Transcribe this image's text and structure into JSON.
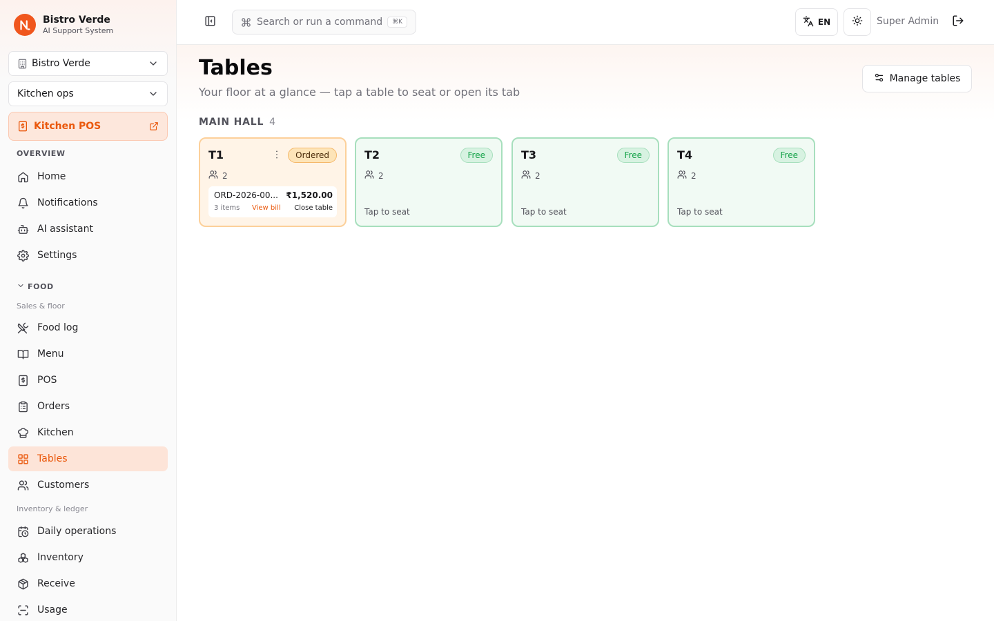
{
  "brand": {
    "name": "Bistro Verde",
    "subtitle": "AI Support System",
    "accent": "#f0561d"
  },
  "sidebar": {
    "restaurant_select": {
      "value": "Bistro Verde"
    },
    "workspace_select": {
      "value": "Kitchen ops"
    },
    "pos_link": {
      "label": "Kitchen POS"
    },
    "overview_label": "OVERVIEW",
    "overview_items": [
      {
        "label": "Home",
        "icon": "home-icon"
      },
      {
        "label": "Notifications",
        "icon": "bell-icon"
      },
      {
        "label": "AI assistant",
        "icon": "bot-icon"
      },
      {
        "label": "Settings",
        "icon": "gear-icon"
      }
    ],
    "food_label": "FOOD",
    "sales_label": "Sales & floor",
    "sales_items": [
      {
        "label": "Food log",
        "icon": "utensils-icon"
      },
      {
        "label": "Menu",
        "icon": "book-icon"
      },
      {
        "label": "POS",
        "icon": "receipt-icon"
      },
      {
        "label": "Orders",
        "icon": "clipboard-icon"
      },
      {
        "label": "Kitchen",
        "icon": "chef-hat-icon"
      },
      {
        "label": "Tables",
        "icon": "grid-icon",
        "active": true
      },
      {
        "label": "Customers",
        "icon": "users-icon"
      }
    ],
    "inventory_label": "Inventory & ledger",
    "inventory_items": [
      {
        "label": "Daily operations",
        "icon": "calendar-clock-icon"
      },
      {
        "label": "Inventory",
        "icon": "boxes-icon"
      },
      {
        "label": "Receive",
        "icon": "package-icon"
      },
      {
        "label": "Usage",
        "icon": "scan-icon"
      }
    ]
  },
  "header": {
    "search_placeholder": "Search or run a command",
    "search_shortcut": "⌘K",
    "language": "EN",
    "user": "Super Admin"
  },
  "page": {
    "title": "Tables",
    "subtitle": "Your floor at a glance — tap a table to seat or open its tab",
    "manage_button": "Manage tables"
  },
  "zone": {
    "name": "MAIN HALL",
    "count": "4",
    "tables": [
      {
        "name": "T1",
        "status": "Ordered",
        "seats": "2",
        "order": {
          "id": "ORD-2026-00...",
          "amount": "₹1,520.00",
          "items": "3 items",
          "view_label": "View bill",
          "close_label": "Close table"
        }
      },
      {
        "name": "T2",
        "status": "Free",
        "seats": "2",
        "hint": "Tap to seat"
      },
      {
        "name": "T3",
        "status": "Free",
        "seats": "2",
        "hint": "Tap to seat"
      },
      {
        "name": "T4",
        "status": "Free",
        "seats": "2",
        "hint": "Tap to seat"
      }
    ]
  },
  "colors": {
    "accent": "#ea580c",
    "free_border": "#a7dfbd",
    "ordered_border": "#fcd09a"
  }
}
